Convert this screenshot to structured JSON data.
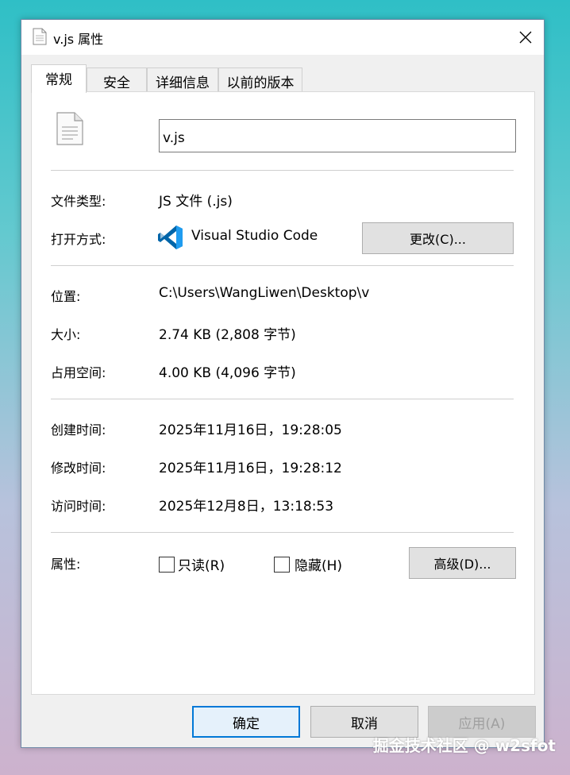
{
  "window": {
    "title": "v.js 属性",
    "close_glyph": "✕"
  },
  "tabs": [
    {
      "label": "常规",
      "active": true
    },
    {
      "label": "安全",
      "active": false
    },
    {
      "label": "详细信息",
      "active": false
    },
    {
      "label": "以前的版本",
      "active": false
    }
  ],
  "general": {
    "file_name": "v.js",
    "file_type_label": "文件类型:",
    "file_type_value": "JS 文件 (.js)",
    "open_with_label": "打开方式:",
    "open_with_app": "Visual Studio Code",
    "change_button": "更改(C)...",
    "location_label": "位置:",
    "location_value": "C:\\Users\\WangLiwen\\Desktop\\v",
    "size_label": "大小:",
    "size_value": "2.74 KB (2,808 字节)",
    "size_on_disk_label": "占用空间:",
    "size_on_disk_value": "4.00 KB (4,096 字节)",
    "created_label": "创建时间:",
    "created_value": "2025年11月16日，19:28:05",
    "modified_label": "修改时间:",
    "modified_value": "2025年11月16日，19:28:12",
    "accessed_label": "访问时间:",
    "accessed_value": "2025年12月8日，13:18:53",
    "attributes_label": "属性:",
    "readonly_label": "只读(R)",
    "readonly_checked": false,
    "hidden_label": "隐藏(H)",
    "hidden_checked": false,
    "advanced_button": "高级(D)..."
  },
  "footer": {
    "ok": "确定",
    "cancel": "取消",
    "apply": "应用(A)"
  },
  "watermark": "掘金技术社区 @ w2sfot",
  "colors": {
    "accent": "#0078d7",
    "vscode_blue": "#0065a9"
  }
}
